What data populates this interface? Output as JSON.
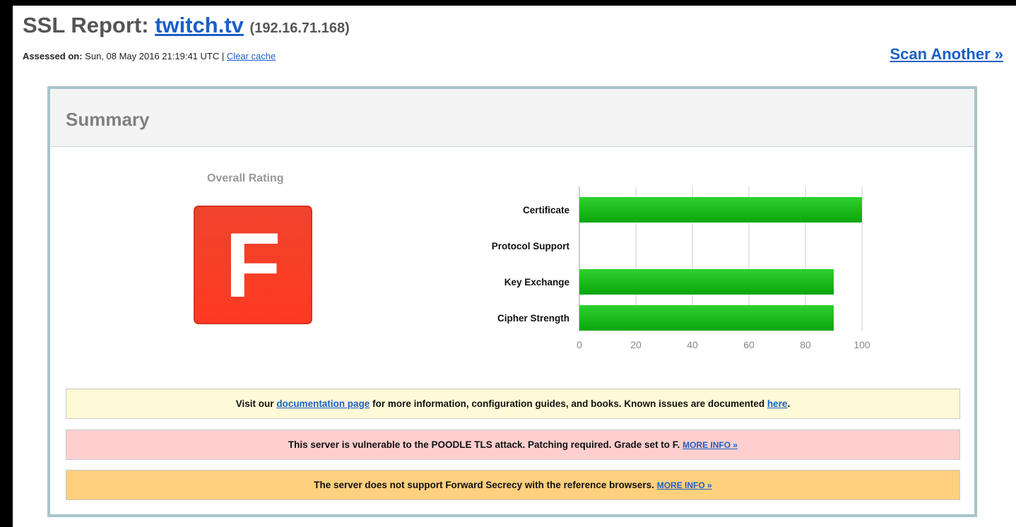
{
  "header": {
    "title_prefix": "SSL Report:",
    "domain": "twitch.tv",
    "ip": "(192.16.71.168)",
    "assessed_label": "Assessed on:",
    "assessed_value": "Sun, 08 May 2016 21:19:41 UTC |",
    "clear_cache": "Clear cache",
    "scan_another": "Scan Another »"
  },
  "summary": {
    "title": "Summary",
    "overall_label": "Overall Rating",
    "grade": "F",
    "grade_color": "#ff3a23"
  },
  "chart_data": {
    "type": "bar",
    "orientation": "horizontal",
    "categories": [
      "Certificate",
      "Protocol Support",
      "Key Exchange",
      "Cipher Strength"
    ],
    "values": [
      100,
      0,
      90,
      90
    ],
    "xlim": [
      0,
      100
    ],
    "ticks": [
      0,
      20,
      40,
      60,
      80,
      100
    ],
    "grid": true,
    "bar_color": "#19b81b"
  },
  "messages": {
    "doc": {
      "pre": "Visit our",
      "link1": "documentation page",
      "mid": "for more information, configuration guides, and books. Known issues are documented",
      "link2": "here",
      "post": "."
    },
    "poodle": {
      "text": "This server is vulnerable to the POODLE TLS attack. Patching required. Grade set to F.",
      "more": "MORE INFO »"
    },
    "fs": {
      "text": "The server does not support Forward Secrecy with the reference browsers.",
      "more": "MORE INFO »"
    }
  }
}
